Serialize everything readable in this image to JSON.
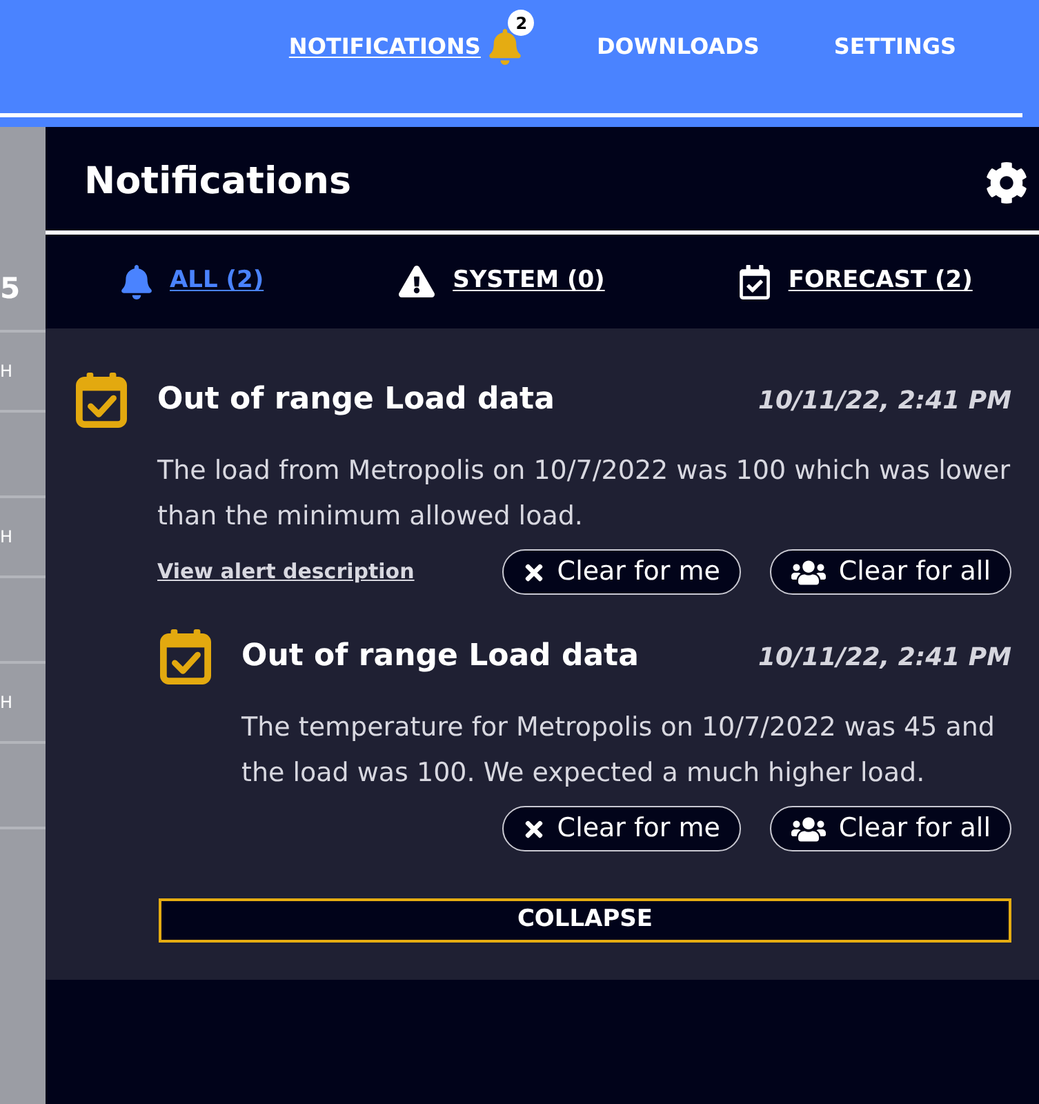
{
  "nav": {
    "items": [
      {
        "label": "NOTIFICATIONS",
        "selected": true,
        "badge": "2"
      },
      {
        "label": "DOWNLOADS",
        "selected": false
      },
      {
        "label": "SETTINGS",
        "selected": false
      }
    ]
  },
  "side_strip": {
    "cells": [
      {
        "kind": "number",
        "label": "5"
      },
      {
        "kind": "unit",
        "label": "H"
      },
      {
        "kind": "number"
      },
      {
        "kind": "unit",
        "label": "H"
      },
      {
        "kind": "number"
      },
      {
        "kind": "unit",
        "label": "H"
      },
      {
        "kind": "number"
      }
    ]
  },
  "panel": {
    "title": "Notifications",
    "tabs": [
      {
        "kind": "all",
        "label": "ALL (2)",
        "selected": true
      },
      {
        "kind": "system",
        "label": "SYSTEM (0)",
        "selected": false
      },
      {
        "kind": "forecast",
        "label": "FORECAST (2)",
        "selected": false
      }
    ],
    "notifications": [
      {
        "title": "Out of range Load data",
        "time": "10/11/22, 2:41 PM",
        "text": "The load from Metropolis on 10/7/2022 was 100 which was lower than the minimum allowed load.",
        "link": "View alert description",
        "actions": [
          {
            "kind": "me",
            "label": "Clear for me"
          },
          {
            "kind": "all",
            "label": "Clear for all"
          }
        ],
        "children": [
          {
            "title": "Out of range Load data",
            "time": "10/11/22, 2:41 PM",
            "text": "The temperature for Metropolis on 10/7/2022 was 45 and the load was 100. We expected a much higher load.",
            "actions": [
              {
                "kind": "me",
                "label": "Clear for me"
              },
              {
                "kind": "all",
                "label": "Clear for all"
              }
            ]
          }
        ]
      }
    ],
    "collapse_button": "COLLAPSE"
  }
}
